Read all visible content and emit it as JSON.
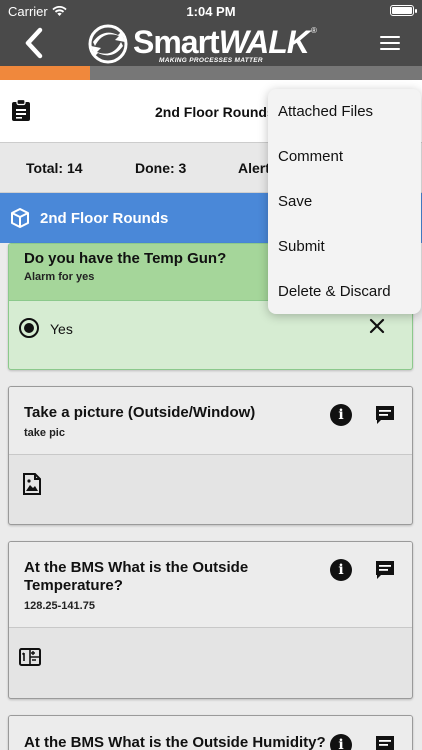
{
  "status_bar": {
    "carrier": "Carrier",
    "time": "1:04 PM"
  },
  "header": {
    "brand_prefix": "Smart",
    "brand_suffix": "WALK",
    "registered": "®",
    "tagline": "MAKING PROCESSES MATTER",
    "icons": {
      "back": "chevron-left-icon",
      "menu": "hamburger-icon"
    }
  },
  "progress": {
    "fraction": 0.214,
    "color": "#f0883c"
  },
  "round": {
    "title": "2nd Floor Rounds"
  },
  "stats": {
    "total": "Total: 14",
    "done": "Done: 3",
    "alerts": "Alerts"
  },
  "section": {
    "title": "2nd Floor Rounds",
    "color": "#4a88d8"
  },
  "questions": [
    {
      "question": "Do you have the Temp Gun?",
      "sub": "Alarm for yes",
      "answer": "Yes",
      "state": "answered"
    },
    {
      "question": "Take a picture (Outside/Window)",
      "sub": "take pic",
      "input": "photo-icon"
    },
    {
      "question_line1": "At the BMS What is the Outside",
      "question_line2": "Temperature?",
      "sub": "128.25-141.75",
      "input": "numeric-keypad-icon"
    },
    {
      "question": "At the BMS What is the Outside Humidity?"
    }
  ],
  "menu": {
    "items": [
      "Attached Files",
      "Comment",
      "Save",
      "Submit",
      "Delete & Discard"
    ]
  },
  "colors": {
    "header_bg": "#4a4a4a",
    "answered_green": "#a5d69a"
  }
}
